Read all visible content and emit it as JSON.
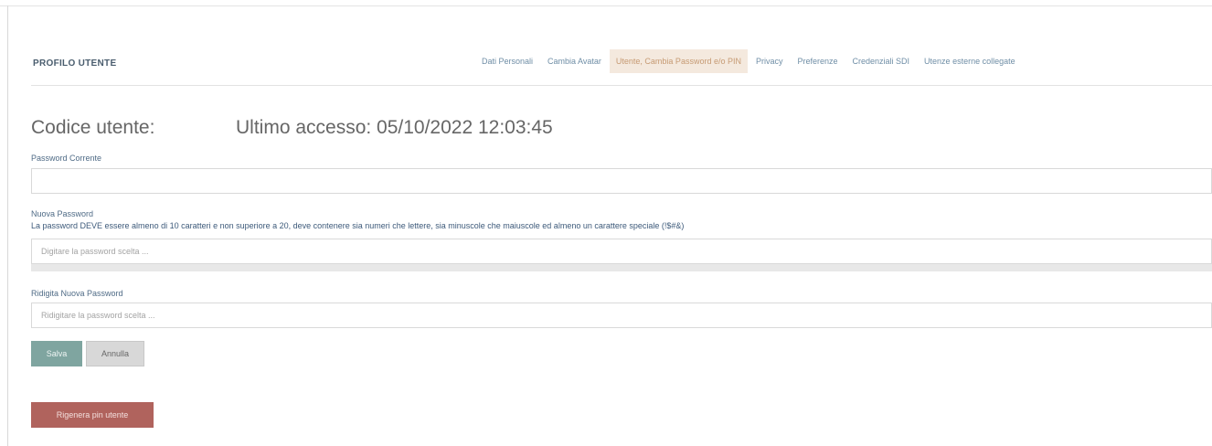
{
  "page": {
    "title": "PROFILO UTENTE"
  },
  "tabs": [
    {
      "label": "Dati Personali",
      "active": false
    },
    {
      "label": "Cambia Avatar",
      "active": false
    },
    {
      "label": "Utente, Cambia Password e/o PIN",
      "active": true
    },
    {
      "label": "Privacy",
      "active": false
    },
    {
      "label": "Preferenze",
      "active": false
    },
    {
      "label": "Credenziali SDI",
      "active": false
    },
    {
      "label": "Utenze esterne collegate",
      "active": false
    }
  ],
  "header": {
    "user_code_label": "Codice utente:",
    "last_access": "Ultimo accesso: 05/10/2022 12:03:45"
  },
  "form": {
    "current_password": {
      "label": "Password Corrente",
      "value": "",
      "placeholder": ""
    },
    "new_password": {
      "label": "Nuova Password",
      "hint": "La password DEVE essere almeno di 10 caratteri e non superiore a 20, deve contenere sia numeri che lettere, sia minuscole che maiuscole ed almeno un carattere speciale (!$#&)",
      "placeholder": "Digitare la password scelta ..."
    },
    "repeat_password": {
      "label": "Ridigita Nuova Password",
      "placeholder": "Ridigitare la password scelta ..."
    }
  },
  "buttons": {
    "save": "Salva",
    "cancel": "Annulla",
    "regenerate": "Rigenera pin utente"
  },
  "colors": {
    "active_tab_bg": "#f4e9de",
    "save_button": "#7fa5a0",
    "regenerate_button": "#b0635d"
  }
}
